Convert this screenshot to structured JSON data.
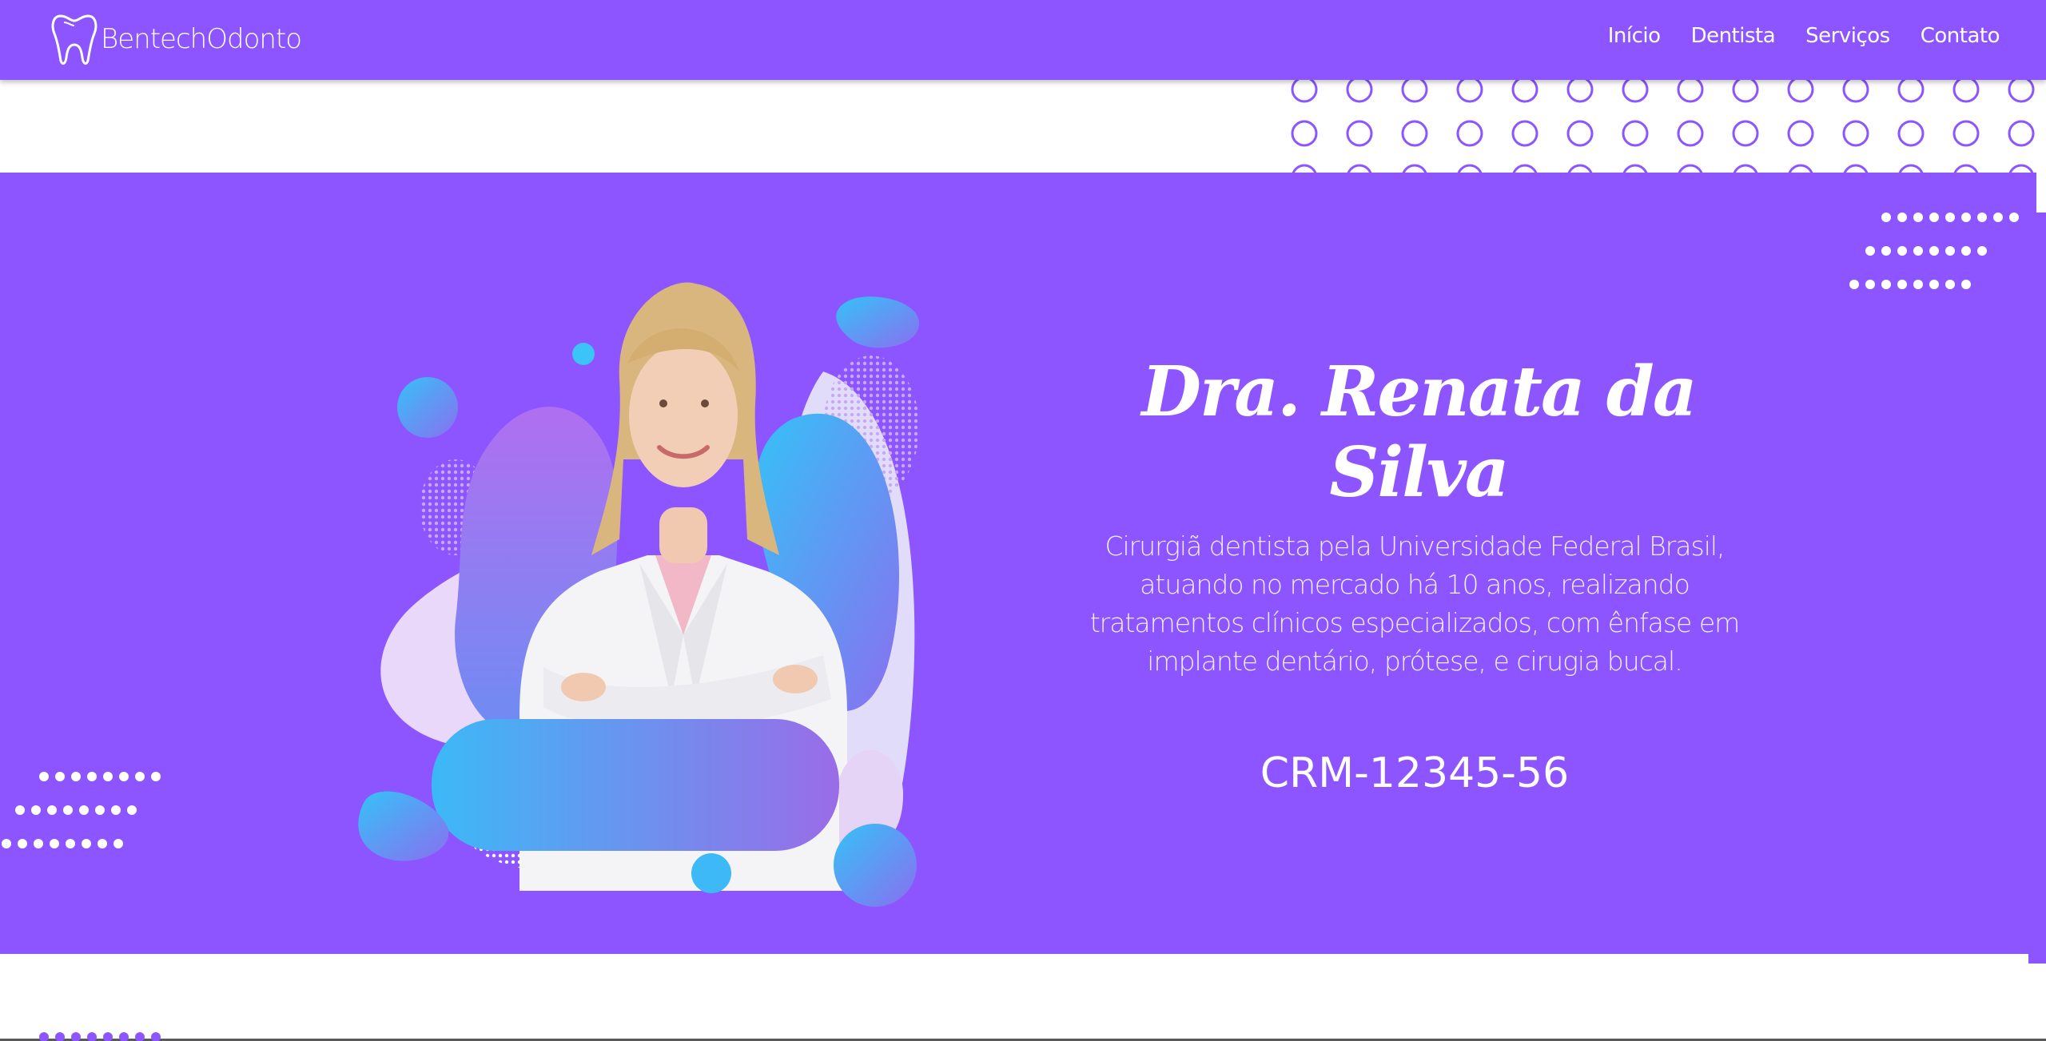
{
  "navbar": {
    "brand": "BentechOdonto",
    "links": [
      "Início",
      "Dentista",
      "Serviços",
      "Contato"
    ]
  },
  "hero": {
    "name": "Dra. Renata da Silva",
    "bio": "Cirurgiã dentista pela Universidade Federal Brasil, atuando no mercado há 10 anos, realizando tratamentos clínicos especializados, com ênfase em implante dentário, prótese, e cirugia bucal.",
    "crm": "CRM-12345-56"
  },
  "colors": {
    "primary": "#8c55ff",
    "accent_blue": "#3fb8f5",
    "accent_lilac": "#e6d4f7",
    "text": "#ffffff"
  },
  "icons": {
    "brand_logo": "tooth-icon"
  }
}
